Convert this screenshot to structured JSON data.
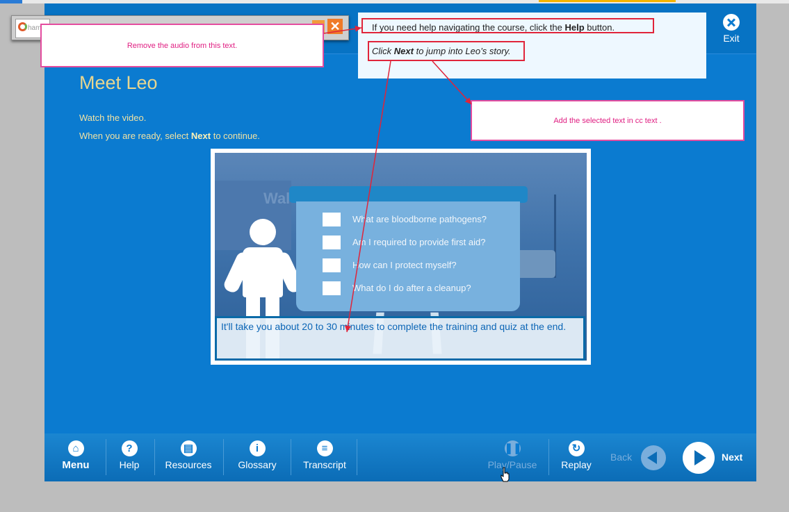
{
  "exit_label": "Exit",
  "page_title": "Meet Leo",
  "instructions": {
    "line1": "Watch the video.",
    "line2_pre": "When you are ready, select ",
    "line2_bold": "Next",
    "line2_post": " to continue."
  },
  "video": {
    "sign": "Wal",
    "questions": [
      "What are bloodborne pathogens?",
      "Am I required to provide first aid?",
      "How can I protect myself?",
      "What do I do after a cleanup?"
    ],
    "caption": "It'll take you about 20 to 30 minutes to complete the training and quiz at the end."
  },
  "popup": {
    "line1_pre": "If you need help navigating the course, click  the ",
    "line1_bold": "Help",
    "line1_post": " button.",
    "line2_pre": "Click ",
    "line2_bold": "Next",
    "line2_post": " to jump into Leo’s story."
  },
  "widget": {
    "logo_text": "ham"
  },
  "notes": {
    "audio": "Remove the audio from this text.",
    "cc": "Add the selected text in cc text ."
  },
  "nav": {
    "menu": "Menu",
    "help": "Help",
    "resources": "Resources",
    "glossary": "Glossary",
    "transcript": "Transcript",
    "playpause": "Play/Pause",
    "replay": "Replay",
    "back": "Back",
    "next": "Next"
  },
  "colors": {
    "course_blue": "#0b7bd0",
    "title_gold": "#e7d690",
    "annotation_red": "#e0243a",
    "note_pink": "#e44c9f"
  }
}
